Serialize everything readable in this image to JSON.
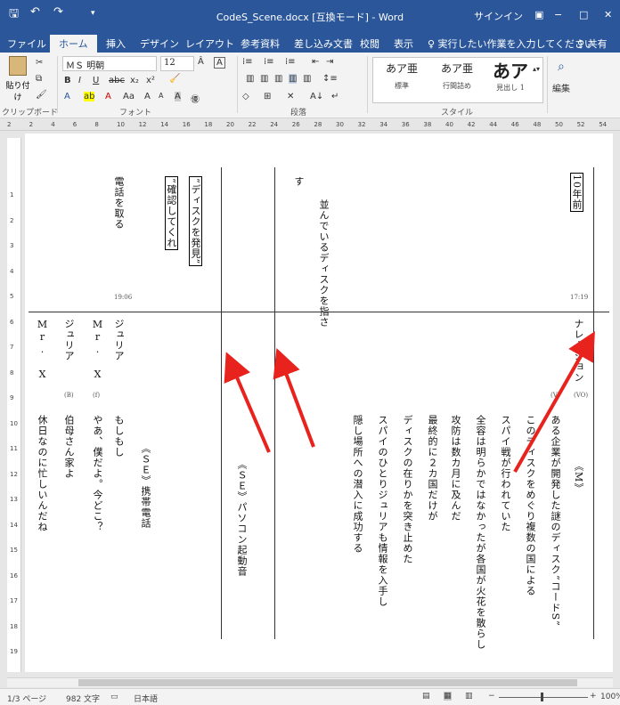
{
  "window": {
    "title": "CodeS_Scene.docx [互換モード] - Word",
    "signin": "サインイン",
    "minimize": "−",
    "maximize": "□",
    "close": "✕"
  },
  "qat": {
    "save": "🖫",
    "undo": "↶",
    "redo": "↷",
    "custom": "▾"
  },
  "tabs": [
    "ファイル",
    "ホーム",
    "挿入",
    "デザイン",
    "レイアウト",
    "参考資料",
    "差し込み文書",
    "校閲",
    "表示"
  ],
  "tellme": "♀ 実行したい作業を入力してください",
  "share": "♀ 共有",
  "ribbon": {
    "clipboard": {
      "label": "クリップボード",
      "paste": "貼り付け"
    },
    "font": {
      "label": "フォント",
      "name": "ＭＳ 明朝",
      "size": "12",
      "bold": "B",
      "italic": "I",
      "underline": "U",
      "strike": "abc",
      "sub": "x₂",
      "sup": "x²",
      "aa": "Aa",
      "grow": "A",
      "shrink": "A",
      "clear": "A"
    },
    "paragraph": {
      "label": "段落"
    },
    "styles": {
      "label": "スタイル",
      "items": [
        {
          "preview": "あア亜",
          "name": "標準"
        },
        {
          "preview": "あア亜",
          "name": "行間詰め"
        },
        {
          "preview": "あア",
          "name": "見出し 1"
        }
      ]
    },
    "editing": {
      "label": "編集"
    }
  },
  "ruler": {
    "ticks": [
      "2",
      "2",
      "4",
      "6",
      "8",
      "10",
      "12",
      "14",
      "16",
      "18",
      "20",
      "22",
      "24",
      "26",
      "28",
      "30",
      "32",
      "34",
      "36",
      "38",
      "40",
      "42",
      "44",
      "46",
      "48",
      "50",
      "52",
      "54"
    ]
  },
  "vruler": {
    "ticks": [
      "1",
      "2",
      "3",
      "4",
      "5",
      "6",
      "7",
      "8",
      "9",
      "10",
      "11",
      "12",
      "13",
      "14",
      "15",
      "16",
      "17",
      "18",
      "19"
    ]
  },
  "doc": {
    "upper": {
      "narration_head": "10年前 ",
      "time1": "17:19",
      "line_a": "並んでいるディスクを指さ",
      "line_b": "す",
      "box1": "“ディスクを発見”",
      "box2": "“確認してくれ",
      "line_c": "電話を取る",
      "time2": "19:06"
    },
    "lower": {
      "narration": "ナレーション",
      "vo": "(VO)",
      "v_tag": "(V)",
      "m_tag": "《M》",
      "lines": [
        "ある企業が開発した謎のディスク“コードS”",
        "このディスクをめぐり複数の国による",
        "スパイ戦が行われていた",
        "全容は明らかではなかったが各国が火花を散らし",
        "攻防は数カ月に及んだ",
        "最終的に２カ国だけが",
        "ディスクの在りかを突き止めた",
        "スパイのひとりジュリアも情報を入手し",
        "隠し場所への潜入に成功する"
      ],
      "se1": "《ＳＥ》パソコン起動音",
      "se2": "《ＳＥ》携帯電話",
      "julia1": "ジュリア",
      "julia1_line": "もしもし",
      "mrx1": "Mr. X",
      "mrx1_tag": "(f)",
      "mrx1_line": "やあ、僕だよ。今どこ？",
      "julia2": "ジュリア",
      "julia2_tag": "(B)",
      "julia2_line": "伯母さん家よ",
      "mrx2": "Mr. X",
      "mrx2_line": "休日なのに忙しいんだね"
    }
  },
  "status": {
    "page": "1/3 ページ",
    "words": "982 文字",
    "lang": "日本語",
    "zoom": "100%"
  },
  "colors": {
    "accent": "#2b579a",
    "arrow": "#e8231e"
  }
}
